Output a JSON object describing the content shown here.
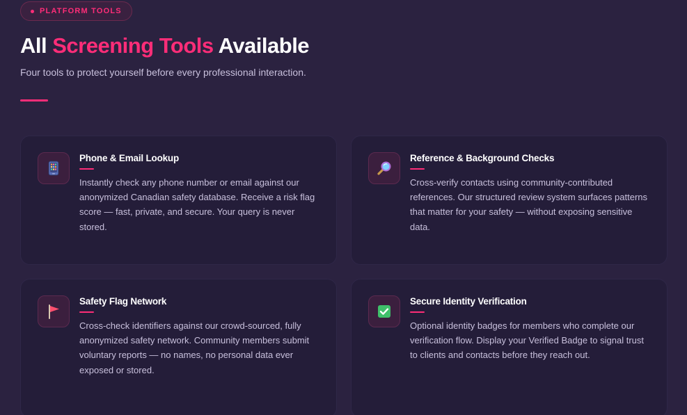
{
  "header": {
    "badge_label": "PLATFORM TOOLS",
    "title_part1": "All",
    "title_accent": "Screening Tools",
    "title_part2": "Available",
    "subtitle": "Four tools to protect yourself before every professional interaction."
  },
  "colors": {
    "background": "#2b2240",
    "card": "#241d39",
    "accent": "#ff2d78",
    "text_muted": "#c8c0dc"
  },
  "tools": [
    {
      "icon": "phone-icon",
      "title": "Phone & Email Lookup",
      "description": "Instantly check any phone number or email against our anonymized Canadian safety database. Receive a risk flag score — fast, private, and secure. Your query is never stored."
    },
    {
      "icon": "magnifying-glass-icon",
      "title": "Reference & Background Checks",
      "description": "Cross-verify contacts using community-contributed references. Our structured review system surfaces patterns that matter for your safety — without exposing sensitive data."
    },
    {
      "icon": "flag-icon",
      "title": "Safety Flag Network",
      "description": "Cross-check identifiers against our crowd-sourced, fully anonymized safety network. Community members submit voluntary reports — no names, no personal data ever exposed or stored."
    },
    {
      "icon": "check-mark-icon",
      "title": "Secure Identity Verification",
      "description": "Optional identity badges for members who complete our verification flow. Display your Verified Badge to signal trust to clients and contacts before they reach out."
    }
  ]
}
